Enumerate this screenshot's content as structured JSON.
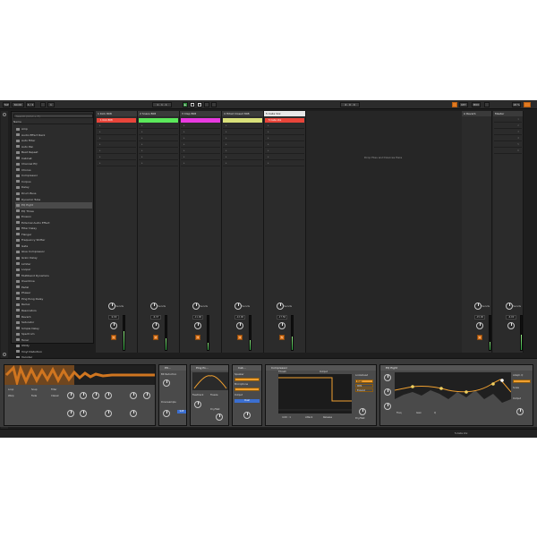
{
  "transport": {
    "tap": "TAP",
    "tempo": "60.00",
    "sig_a": "4 / 4",
    "bars": "1",
    "pos": "1 . 1 . 1",
    "end": "4 . 0 . 0",
    "key": "KEY",
    "midi": "MIDI",
    "cpu": "18 %"
  },
  "browser": {
    "search_placeholder": "Search (Cmd + F)",
    "header": "Name",
    "items": [
      {
        "label": "Amp"
      },
      {
        "label": "Audio Effect Rack"
      },
      {
        "label": "Auto Filter"
      },
      {
        "label": "Auto Pan"
      },
      {
        "label": "Beat Repeat"
      },
      {
        "label": "Cabinet"
      },
      {
        "label": "Channel EQ"
      },
      {
        "label": "Chorus"
      },
      {
        "label": "Compressor"
      },
      {
        "label": "Corpus"
      },
      {
        "label": "Delay"
      },
      {
        "label": "Drum Buss"
      },
      {
        "label": "Dynamic Tube"
      },
      {
        "label": "EQ Eight"
      },
      {
        "label": "EQ Three"
      },
      {
        "label": "Erosion"
      },
      {
        "label": "External Audio Effect"
      },
      {
        "label": "Filter Delay"
      },
      {
        "label": "Flanger"
      },
      {
        "label": "Frequency Shifter"
      },
      {
        "label": "Gate"
      },
      {
        "label": "Glue Compressor"
      },
      {
        "label": "Grain Delay"
      },
      {
        "label": "Limiter"
      },
      {
        "label": "Looper"
      },
      {
        "label": "Multiband Dynamics"
      },
      {
        "label": "Overdrive"
      },
      {
        "label": "Pedal"
      },
      {
        "label": "Phaser"
      },
      {
        "label": "Ping Pong Delay"
      },
      {
        "label": "Redux"
      },
      {
        "label": "Resonators"
      },
      {
        "label": "Reverb"
      },
      {
        "label": "Saturator"
      },
      {
        "label": "Simple Delay"
      },
      {
        "label": "Spectrum"
      },
      {
        "label": "Tuner"
      },
      {
        "label": "Utility"
      },
      {
        "label": "Vinyl Distortion"
      },
      {
        "label": "Vocoder"
      }
    ],
    "selected_index": 13
  },
  "tracks": [
    {
      "name": "1 Kick 808",
      "clip": "1 Kick 808",
      "clip_color": "#e8453a",
      "vol": "-9.00",
      "num": "1",
      "sends": "Sends",
      "level": 0.55
    },
    {
      "name": "2 Snare 808",
      "clip": "",
      "clip_color": "#5be85b",
      "vol": "-6.37",
      "num": "2",
      "sends": "Sends",
      "level": 0.35
    },
    {
      "name": "3 Clap 808",
      "clip": "",
      "clip_color": "#e83ae0",
      "vol": "-11.00",
      "num": "3",
      "sends": "Sends",
      "level": 0.2
    },
    {
      "name": "4 Hihat Closed 808",
      "clip": "",
      "clip_color": "#d9e07a",
      "vol": "-12.00",
      "num": "4",
      "sends": "Sends",
      "level": 0.3
    },
    {
      "name": "5 Cabs Vox",
      "clip": "5 Cabs Vox",
      "clip_color": "#e8453a",
      "vol": "-17.50",
      "num": "5",
      "sends": "Sends",
      "level": 0.4
    }
  ],
  "return_track": {
    "name": "A Reverb",
    "vol": "-15.00",
    "num": "A",
    "sends": "Sends",
    "level": 0.25
  },
  "master_track": {
    "name": "Master",
    "vol": "-6.00",
    "sends": "Sends",
    "level": 0.45,
    "scenes": [
      "1",
      "2",
      "3",
      "4",
      "5",
      "6"
    ]
  },
  "drop_hint": "Drop Files and Devices Here",
  "devices": {
    "sampler": {
      "title": "Simpler",
      "labels": [
        "Loop",
        "Filter",
        "Warp",
        "Classic",
        "Snap",
        "Fade"
      ]
    },
    "device2": {
      "title": "Pit...",
      "labels": [
        "Bit Reduction",
        "Downsample",
        "Soft"
      ]
    },
    "device3": {
      "title": "Ping Po...",
      "labels": [
        "Feedback",
        "Freeze",
        "Dry/Wet"
      ]
    },
    "device4": {
      "title": "Cab...",
      "labels": [
        "Speaker",
        "Microphone",
        "Output",
        "Dual"
      ]
    },
    "compressor": {
      "title": "Compressor",
      "labels": [
        "Thresh",
        "Ratio",
        "Attack",
        "Release",
        "Output",
        "Knee",
        "Lookahead",
        "Sidechain",
        "Dry/Wet"
      ],
      "ratio": "4.00 : 1",
      "options": [
        "Peak",
        "RMS",
        "Expand"
      ]
    },
    "eq": {
      "title": "EQ Eight",
      "labels": [
        "Freq",
        "Gain",
        "Q",
        "Adapt. Q",
        "Scale",
        "Output"
      ]
    }
  },
  "colors": {
    "accent": "#e07a22",
    "background": "#1e1e1e",
    "panel": "#2b2b2b"
  },
  "status": {
    "track_label": "5-Cabs Vox"
  }
}
